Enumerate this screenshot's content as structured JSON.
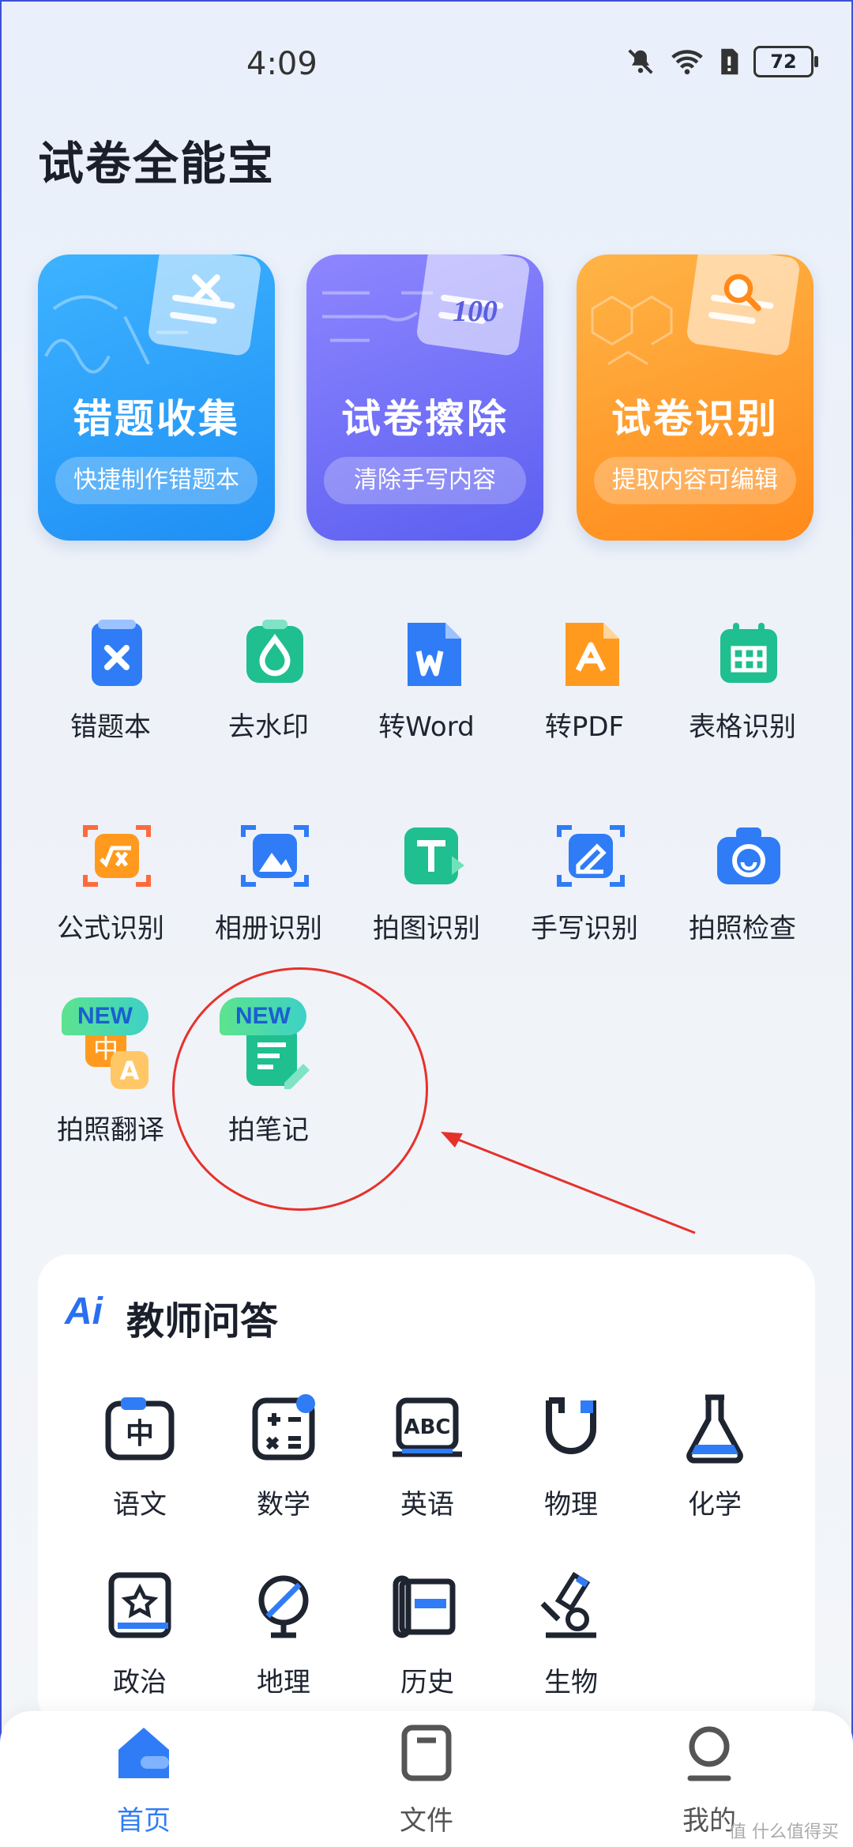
{
  "status": {
    "time": "4:09",
    "battery": "72"
  },
  "app": {
    "title": "试卷全能宝"
  },
  "cards": [
    {
      "title": "错题收集",
      "subtitle": "快捷制作错题本"
    },
    {
      "title": "试卷擦除",
      "subtitle": "清除手写内容"
    },
    {
      "title": "试卷识别",
      "subtitle": "提取内容可编辑"
    }
  ],
  "tools": [
    {
      "label": "错题本"
    },
    {
      "label": "去水印"
    },
    {
      "label": "转Word"
    },
    {
      "label": "转PDF"
    },
    {
      "label": "表格识别"
    },
    {
      "label": "公式识别"
    },
    {
      "label": "相册识别"
    },
    {
      "label": "拍图识别"
    },
    {
      "label": "手写识别"
    },
    {
      "label": "拍照检查"
    },
    {
      "label": "拍照翻译",
      "badge": "NEW"
    },
    {
      "label": "拍笔记",
      "badge": "NEW"
    }
  ],
  "ai": {
    "logo": "Ai",
    "title": "教师问答",
    "subjects": [
      {
        "label": "语文"
      },
      {
        "label": "数学"
      },
      {
        "label": "英语"
      },
      {
        "label": "物理"
      },
      {
        "label": "化学"
      },
      {
        "label": "政治"
      },
      {
        "label": "地理"
      },
      {
        "label": "历史"
      },
      {
        "label": "生物"
      }
    ]
  },
  "nav": {
    "home": "首页",
    "files": "文件",
    "mine": "我的"
  },
  "watermark": "值 什么值得买",
  "colors": {
    "accent": "#2a6ff0",
    "annotation": "#e6312b"
  }
}
